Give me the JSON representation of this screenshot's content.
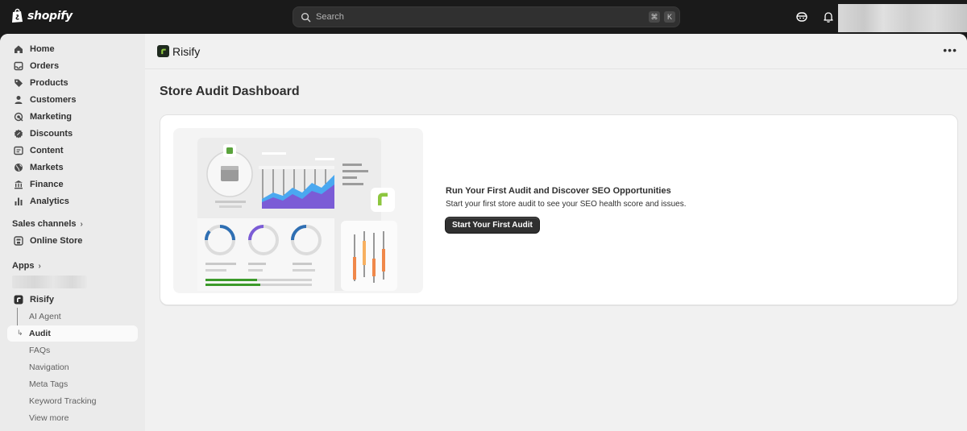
{
  "topbar": {
    "brand": "shopify",
    "search": {
      "placeholder": "Search",
      "shortcut_mod": "⌘",
      "shortcut_key": "K"
    },
    "icons": [
      "assistant-icon",
      "bell-icon"
    ]
  },
  "sidebar": {
    "items": [
      {
        "label": "Home",
        "icon": "home-icon"
      },
      {
        "label": "Orders",
        "icon": "inbox-icon"
      },
      {
        "label": "Products",
        "icon": "tag-icon"
      },
      {
        "label": "Customers",
        "icon": "person-icon"
      },
      {
        "label": "Marketing",
        "icon": "target-icon"
      },
      {
        "label": "Discounts",
        "icon": "discount-icon"
      },
      {
        "label": "Content",
        "icon": "content-icon"
      },
      {
        "label": "Markets",
        "icon": "globe-icon"
      },
      {
        "label": "Finance",
        "icon": "bank-icon"
      },
      {
        "label": "Analytics",
        "icon": "bar-chart-icon"
      }
    ],
    "sales_channels_label": "Sales channels",
    "online_store_label": "Online Store",
    "apps_label": "Apps",
    "app": {
      "name": "Risify",
      "subitems": [
        "AI Agent",
        "Audit",
        "FAQs",
        "Navigation",
        "Meta Tags",
        "Keyword Tracking",
        "View more"
      ],
      "active_subitem": "Audit"
    }
  },
  "app_header": {
    "title": "Risify",
    "menu_icon": "more-horizontal-icon"
  },
  "page": {
    "title": "Store Audit Dashboard",
    "card": {
      "heading": "Run Your First Audit and Discover SEO Opportunities",
      "description": "Start your first store audit to see your SEO health score and issues.",
      "button_label": "Start Your First Audit"
    }
  },
  "colors": {
    "topbar": "#1a1a1a",
    "shell": "#f1f1f1",
    "accent_green": "#8dc63f",
    "chart_blue": "#4a9be8",
    "chart_purple": "#7b5cd6"
  }
}
